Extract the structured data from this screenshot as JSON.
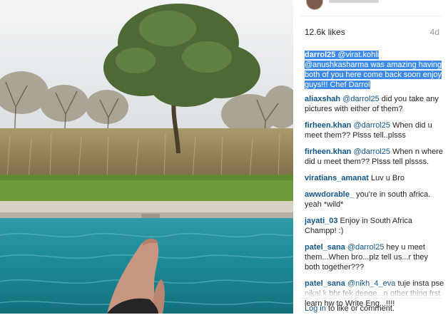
{
  "post": {
    "likes": "12.6k likes",
    "age": "4d"
  },
  "comments": [
    {
      "user": "darrol25",
      "mentions": "@virat.kohli @anushkasharma",
      "text": "was amazing having both of you here come back soon enjoy guys!!! Chef Darrol"
    },
    {
      "user": "aliaxshah",
      "mentions": "@darrol25",
      "text": "did you take any pictures with either of them?"
    },
    {
      "user": "firheen.khan",
      "mentions": "@darrol25",
      "text": "When did u meet them?? Plsss tell..plsss"
    },
    {
      "user": "firheen.khan",
      "mentions": "@darrol25",
      "text": "When n where did u meet them?? Plsss tell plssss."
    },
    {
      "user": "viratians_amanat",
      "mentions": "",
      "text": "Luv u Bro"
    },
    {
      "user": "awwdorable_",
      "mentions": "",
      "text": "you're in south africa. yeah *wild*"
    },
    {
      "user": "jayati_03",
      "mentions": "",
      "text": "Enjoy in South Africa Champp! :)"
    },
    {
      "user": "patel_sana",
      "mentions": "@darrol25",
      "text": "hey u meet them...When bro...plz tell us...r they both together???"
    },
    {
      "user": "patel_sana",
      "mentions": "@nikh_4_eva",
      "text": "tuje insta pse nikal k bhr fek denge...n other thing frst learn hw to Write Eng...!!!!"
    }
  ],
  "footer": {
    "login_link": "Log in",
    "rest": "to like or comment."
  },
  "colors": {
    "link": "#125688",
    "highlight": "#3d8ae9",
    "pool": "#1a8a99",
    "grass": "#6f9a3a"
  }
}
